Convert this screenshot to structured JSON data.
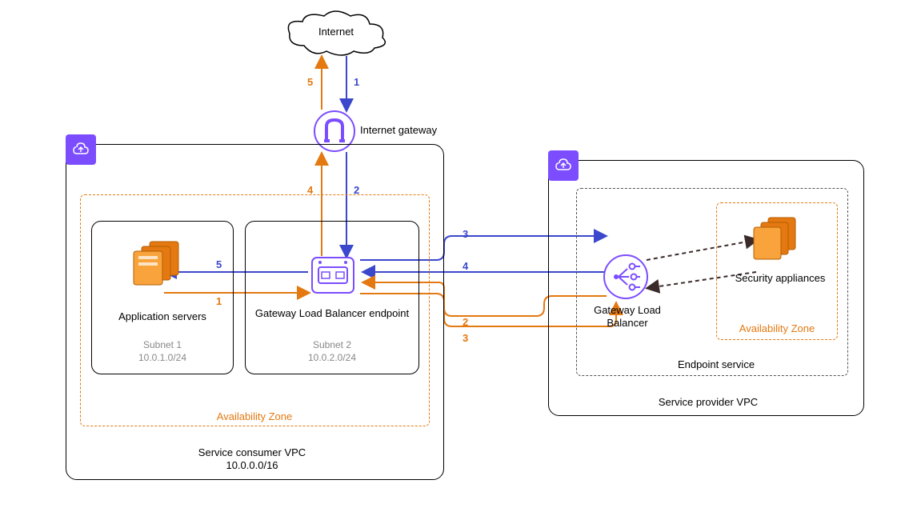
{
  "internet": {
    "label": "Internet"
  },
  "internetGateway": {
    "label": "Internet gateway"
  },
  "consumerVpc": {
    "title": "Service consumer VPC",
    "cidr": "10.0.0.0/16",
    "az_label": "Availability Zone",
    "subnet1": {
      "title": "Application servers",
      "name": "Subnet 1",
      "cidr": "10.0.1.0/24"
    },
    "subnet2": {
      "title": "Gateway Load Balancer endpoint",
      "name": "Subnet 2",
      "cidr": "10.0.2.0/24"
    }
  },
  "providerVpc": {
    "title": "Service provider VPC",
    "endpoint_service": "Endpoint service",
    "az_label": "Availability Zone",
    "glb": "Gateway Load Balancer",
    "appliances": "Security appliances"
  },
  "flows": {
    "blue_1": "1",
    "blue_2": "2",
    "blue_3": "3",
    "blue_4": "4",
    "blue_5": "5",
    "orange_1": "1",
    "orange_2": "2",
    "orange_3": "3",
    "orange_4": "4",
    "orange_5": "5"
  }
}
